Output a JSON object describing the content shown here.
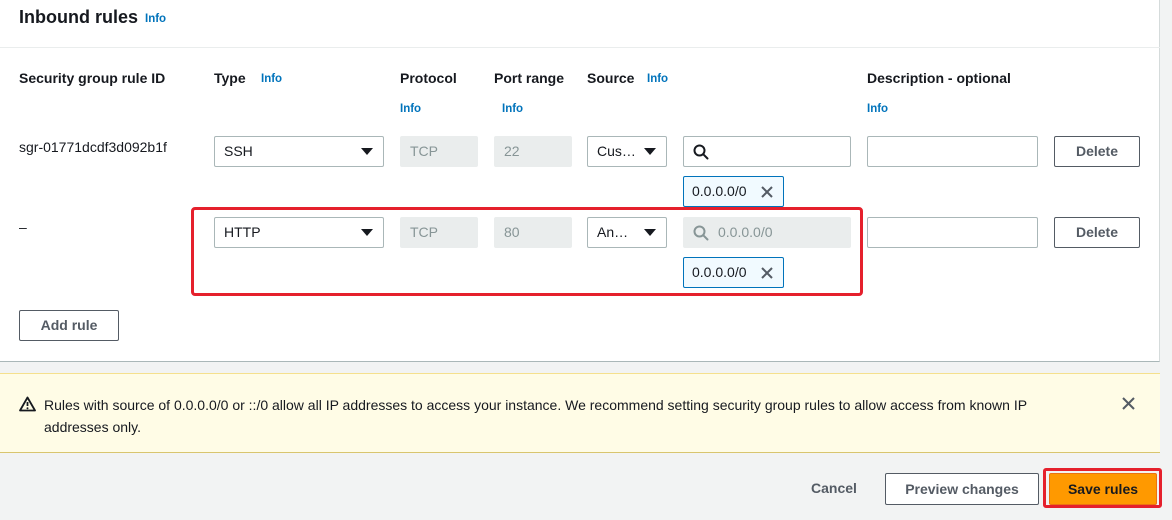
{
  "section": {
    "title": "Inbound rules",
    "info_label": "Info"
  },
  "columns": {
    "rule_id": "Security group rule ID",
    "type": "Type",
    "protocol": "Protocol",
    "port_range": "Port range",
    "source": "Source",
    "description": "Description - optional",
    "info": "Info"
  },
  "rules": [
    {
      "rule_id": "sgr-01771dcdf3d092b1f",
      "type": "SSH",
      "protocol": "TCP",
      "port_range": "22",
      "source_type": "Cus…",
      "source_search_value": "",
      "source_token": "0.0.0.0/0",
      "description": "",
      "delete_label": "Delete"
    },
    {
      "rule_id": "–",
      "type": "HTTP",
      "protocol": "TCP",
      "port_range": "80",
      "source_type": "An…",
      "source_search_placeholder": "0.0.0.0/0",
      "source_token": "0.0.0.0/0",
      "description": "",
      "delete_label": "Delete"
    }
  ],
  "add_rule_label": "Add rule",
  "alert": {
    "text": "Rules with source of 0.0.0.0/0 or ::/0 allow all IP addresses to access your instance. We recommend setting security group rules to allow access from known IP addresses only."
  },
  "footer": {
    "cancel_label": "Cancel",
    "preview_label": "Preview changes",
    "save_label": "Save rules"
  },
  "colors": {
    "info_link": "#0073bb",
    "primary_button": "#ff9900",
    "highlight_outline": "#e5202c",
    "warning_bg": "#fffce6"
  },
  "icons": [
    "search-icon",
    "dismiss-token-icon",
    "caret-down-icon",
    "warning-icon",
    "close-icon"
  ]
}
